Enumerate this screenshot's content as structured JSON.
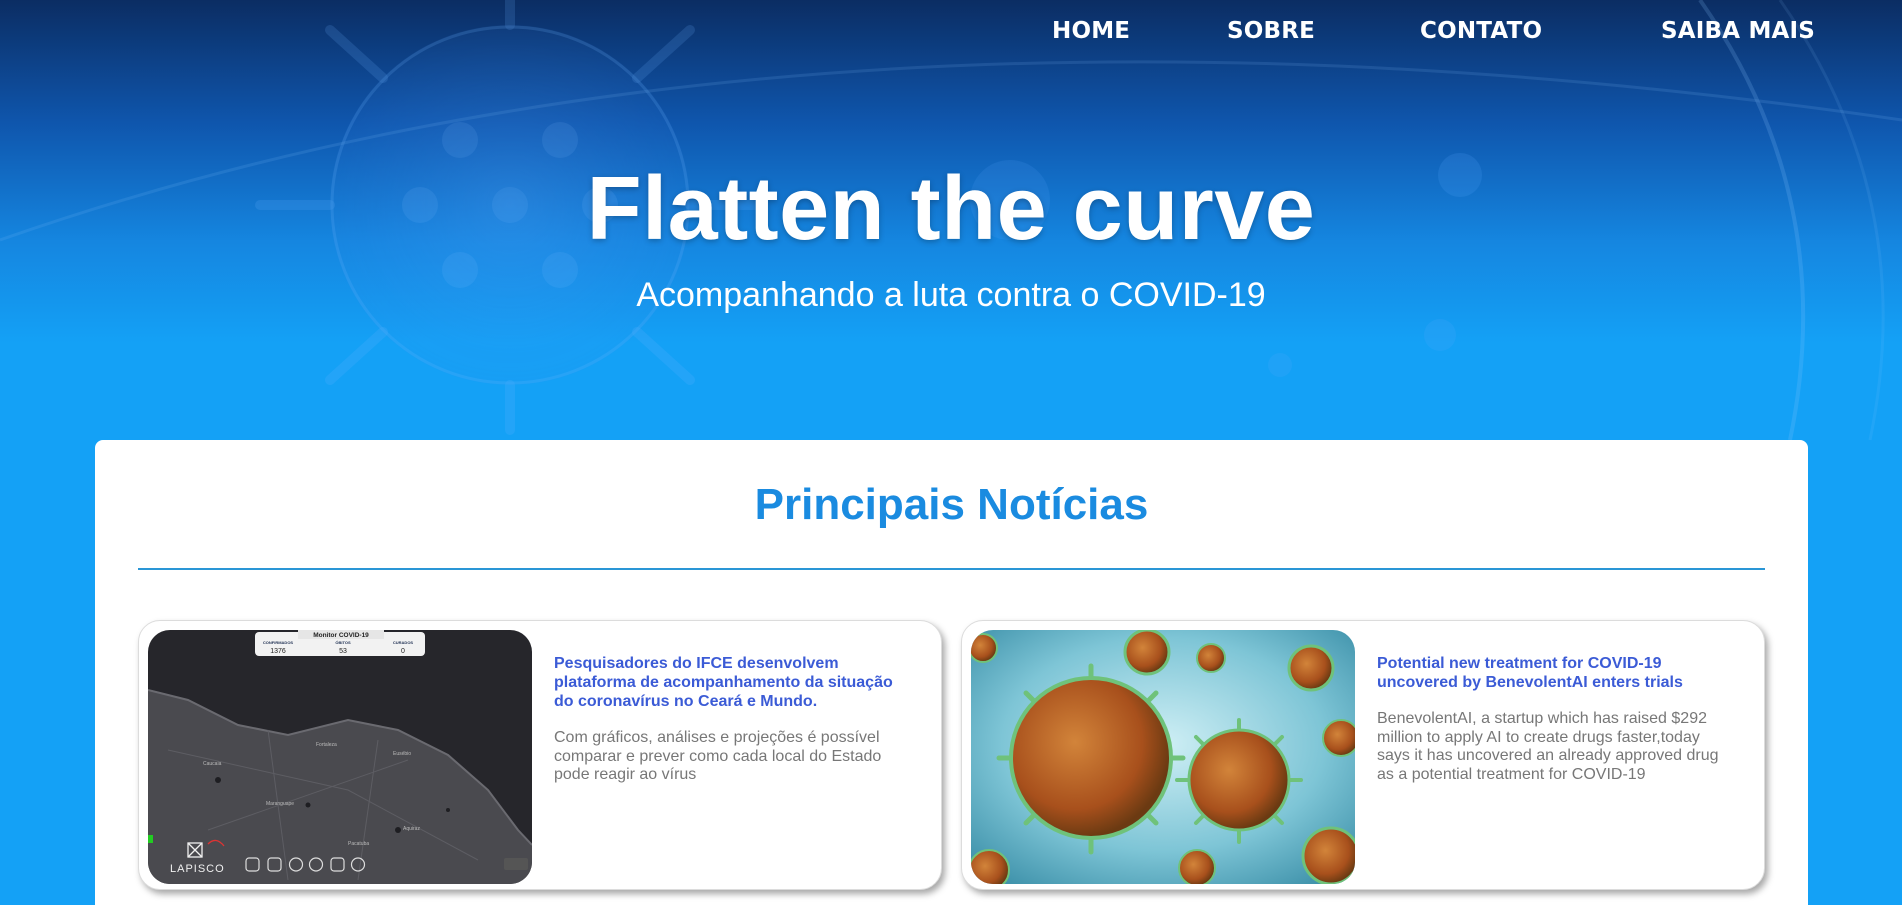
{
  "nav": {
    "items": [
      "HOME",
      "SOBRE",
      "CONTATO",
      "SAIBA MAIS"
    ]
  },
  "hero": {
    "title": "Flatten the curve",
    "subtitle": "Acompanhando a luta contra o COVID-19"
  },
  "news": {
    "heading": "Principais Notícias",
    "cards": [
      {
        "title": "Pesquisadores do IFCE desenvolvem plataforma de acompanhamento da situação do coronavírus no Ceará e Mundo.",
        "description": "Com gráficos, análises e projeções é possível comparar e prever como cada local do Estado pode reagir ao vírus",
        "image": {
          "banner_title": "Monitor COVID-19",
          "stat_labels": [
            "CONFIRMADOS",
            "ÓBITOS",
            "CURADOS"
          ],
          "stat_values": [
            "1376",
            "53",
            "0"
          ],
          "map_labels": [
            "Caucaia",
            "Fortaleza",
            "Maranguape",
            "Eusébio",
            "Aquiraz",
            "Pacatuba"
          ],
          "logo": "LAPISCO"
        }
      },
      {
        "title": "Potential new treatment for COVID-19 uncovered by BenevolentAI enters trials",
        "description": "BenevolentAI, a startup which has raised $292 million to apply AI to create drugs faster,today says it has uncovered an already approved drug as a potential treatment for COVID-19",
        "image": {
          "subject": "coronavirus-particles"
        }
      }
    ]
  },
  "colors": {
    "accent": "#1a8be0",
    "card_title": "#3b5bd6",
    "background": "#14a1f6"
  }
}
